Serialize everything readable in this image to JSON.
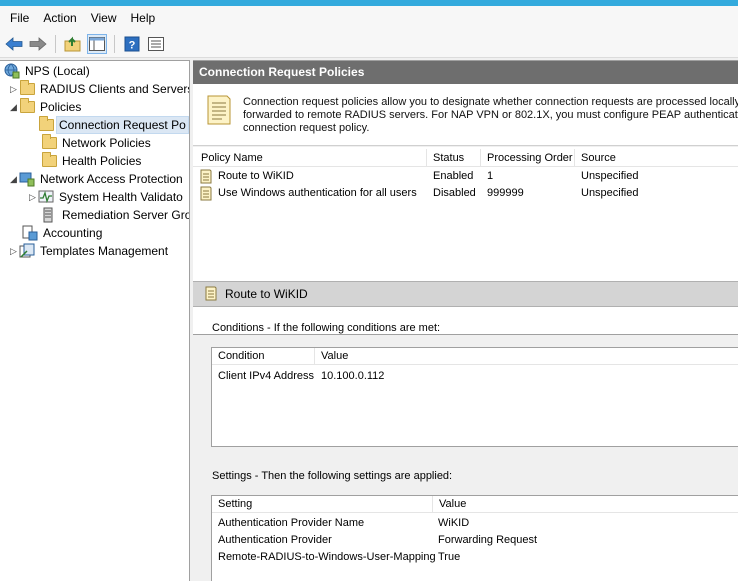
{
  "menu": {
    "items": [
      "File",
      "Action",
      "View",
      "Help"
    ]
  },
  "toolbar": {
    "buttons": [
      "back-arrow-icon",
      "forward-arrow-icon",
      "up-folder-icon",
      "show-hide-tree-icon",
      "help-icon",
      "properties-icon"
    ]
  },
  "tree": {
    "root": "NPS (Local)",
    "radius_clients": "RADIUS Clients and Servers",
    "policies": "Policies",
    "connection_request": "Connection Request Po",
    "network_policies": "Network Policies",
    "health_policies": "Health Policies",
    "nap": "Network Access Protection",
    "shv": "System Health Validato",
    "remediation": "Remediation Server Gro",
    "accounting": "Accounting",
    "templates": "Templates Management"
  },
  "header": {
    "title": "Connection Request Policies"
  },
  "info": {
    "line1": "Connection request policies allow you to designate whether connection requests are processed locally or",
    "line2": "forwarded to remote RADIUS servers. For NAP VPN or 802.1X, you must configure PEAP authentication",
    "line3": "connection request policy."
  },
  "policy_table": {
    "columns": [
      "Policy Name",
      "Status",
      "Processing Order",
      "Source"
    ],
    "rows": [
      [
        "Route to WiKID",
        "Enabled",
        "1",
        "Unspecified"
      ],
      [
        "Use Windows authentication for all users",
        "Disabled",
        "999999",
        "Unspecified"
      ]
    ]
  },
  "detail": {
    "title": "Route to WiKID",
    "conditions_label": "Conditions - If the following conditions are met:",
    "conditions_columns": [
      "Condition",
      "Value"
    ],
    "conditions_rows": [
      [
        "Client IPv4 Address",
        "10.100.0.112"
      ]
    ],
    "settings_label": "Settings - Then the following settings are applied:",
    "settings_columns": [
      "Setting",
      "Value"
    ],
    "settings_rows": [
      [
        "Authentication Provider Name",
        "WiKID"
      ],
      [
        "Authentication Provider",
        "Forwarding Request"
      ],
      [
        "Remote-RADIUS-to-Windows-User-Mapping",
        "True"
      ]
    ]
  }
}
